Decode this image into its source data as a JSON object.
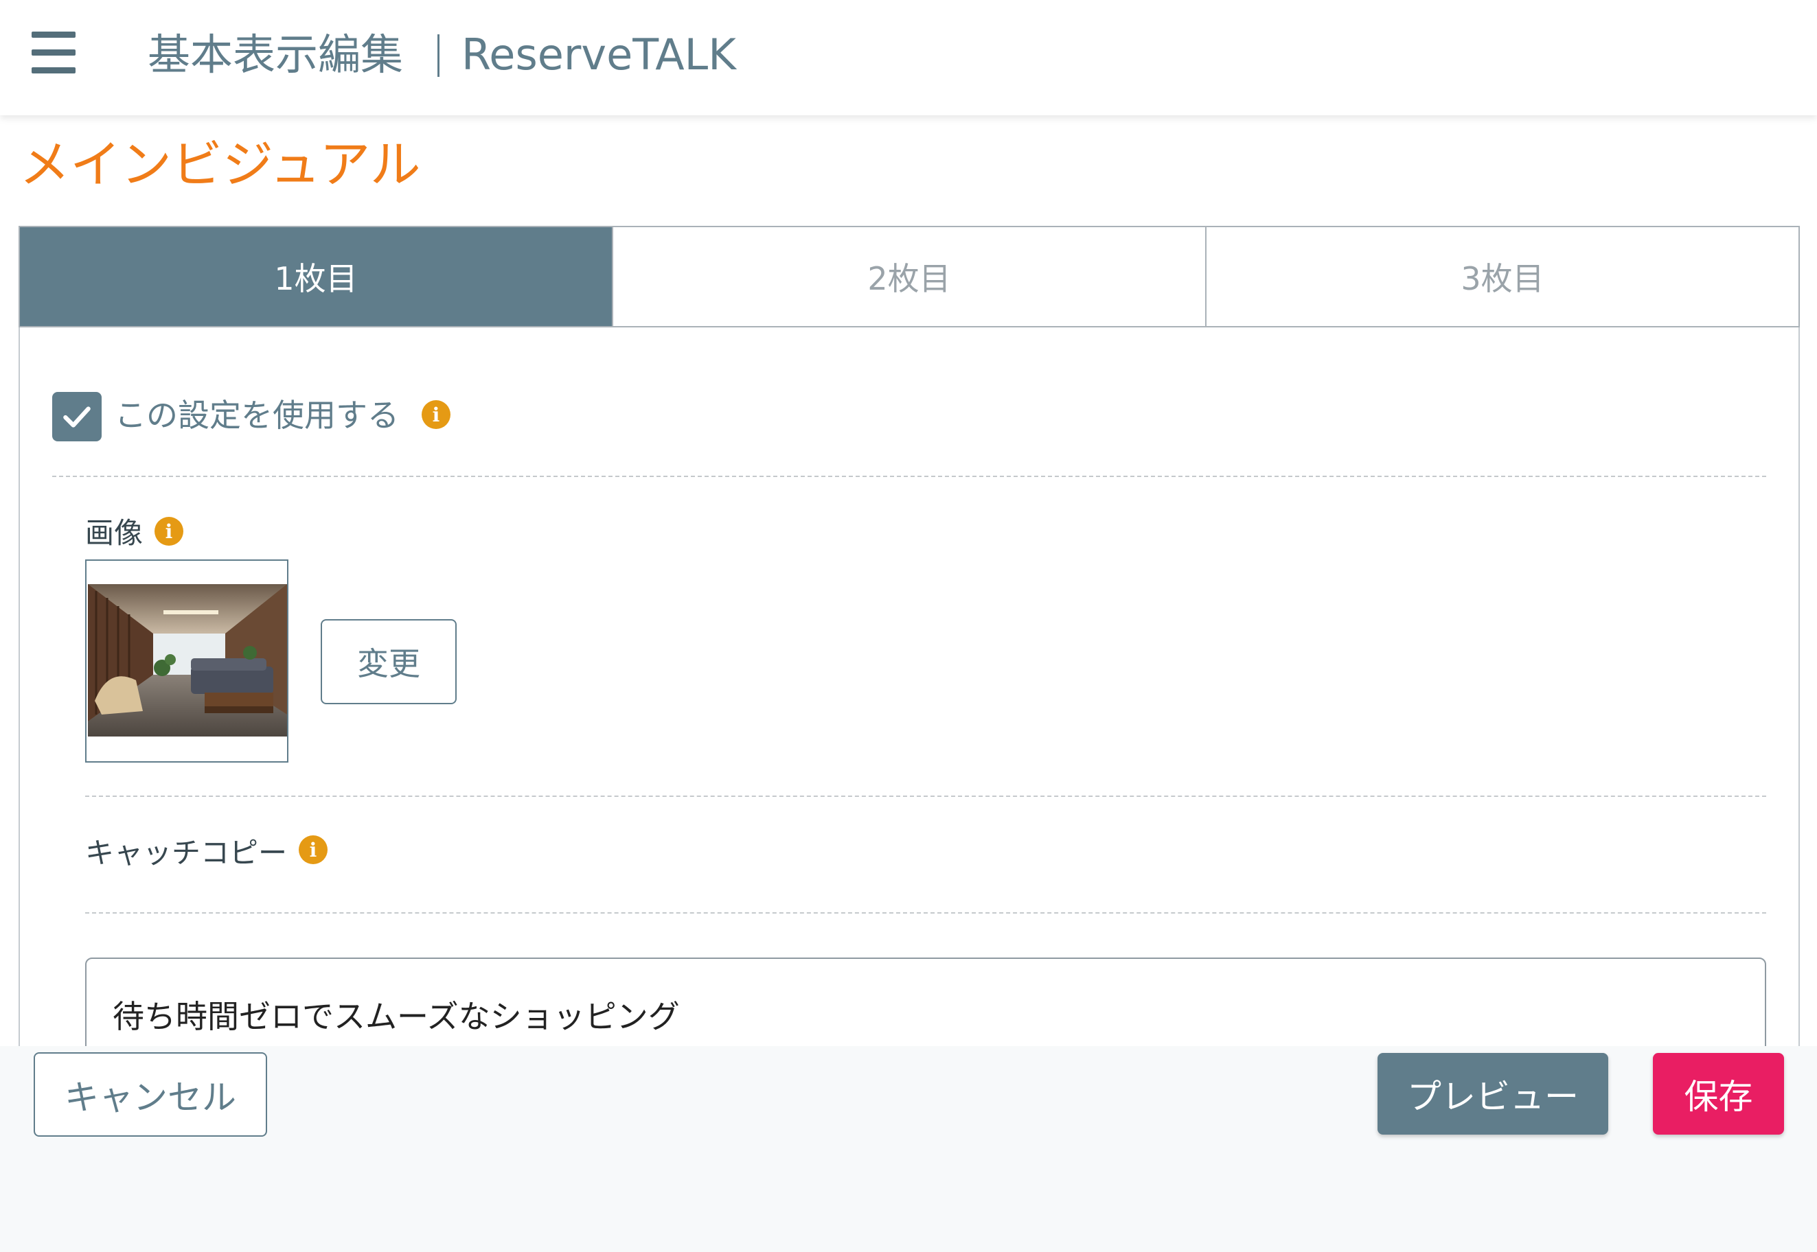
{
  "header": {
    "title": "基本表示編集",
    "app_name": "ReserveTALK"
  },
  "section": {
    "title": "メインビジュアル"
  },
  "tabs": [
    {
      "label": "1枚目",
      "active": true
    },
    {
      "label": "2枚目",
      "active": false
    },
    {
      "label": "3枚目",
      "active": false
    }
  ],
  "use_setting": {
    "label": "この設定を使用する",
    "checked": true
  },
  "image_field": {
    "label": "画像",
    "change_label": "変更"
  },
  "catch_copy": {
    "label": "キャッチコピー",
    "value": "待ち時間ゼロでスムーズなショッピング"
  },
  "footer": {
    "cancel_label": "キャンセル",
    "preview_label": "プレビュー",
    "save_label": "保存"
  },
  "colors": {
    "accent": "#607d8b",
    "section_title": "#f07c18",
    "info_badge": "#e59a14",
    "save": "#e91e63"
  },
  "icons": [
    "menu-icon",
    "check-icon",
    "info-icon"
  ]
}
